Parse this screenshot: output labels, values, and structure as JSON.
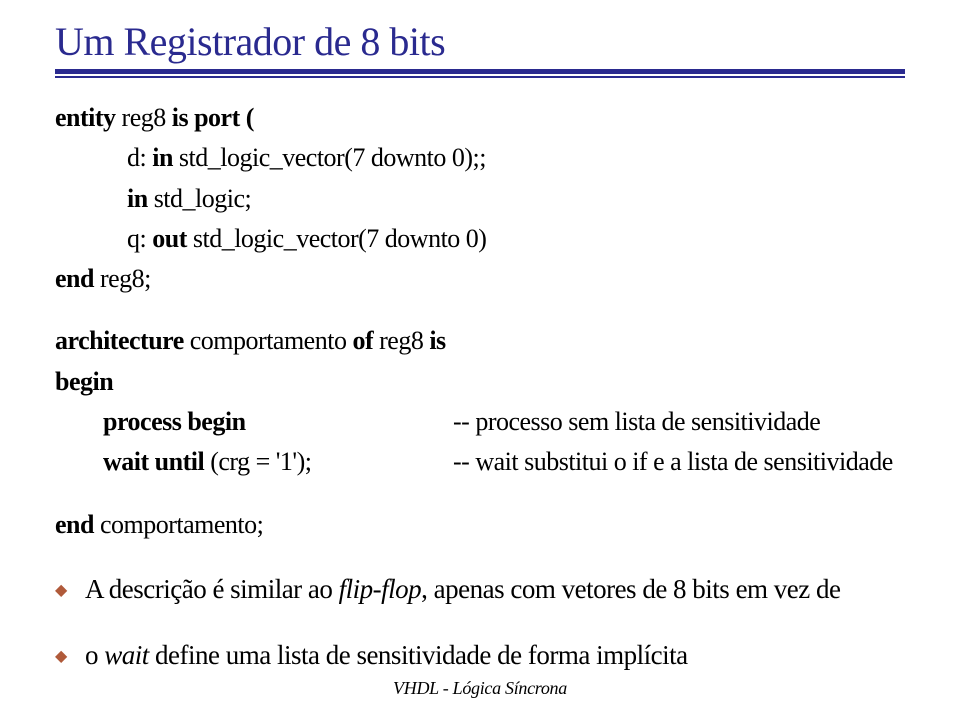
{
  "title": "Um Registrador de 8 bits",
  "code": {
    "l1a": "entity",
    "l1b": " reg8 ",
    "l1c": "is port (",
    "l2a": "d: ",
    "l2b": "in",
    "l2c": " std_logic_vector(7 downto 0);;",
    "l3a": "in",
    "l3b": " std_logic;",
    "l4a": "q: ",
    "l4b": "out",
    "l4c": " std_logic_vector(7 downto 0)",
    "l5a": "end",
    "l5b": " reg8;",
    "l6a": "architecture",
    "l6b": " comportamento ",
    "l6c": "of",
    "l6d": " reg8 ",
    "l6e": "is",
    "l7a": "begin",
    "l8a": "process begin",
    "l8c": "-- processo sem lista de sensitividade",
    "l9a": "wait until",
    "l9b": " (crg = '1');",
    "l9c": "-- wait substitui o if e a lista de sensitividade",
    "l10a": "end",
    "l10b": " comportamento;"
  },
  "bullets": {
    "b1a": "A descrição é similar ao ",
    "b1b": "flip-flop",
    "b1c": ", apenas com vetores de 8 bits em vez de",
    "b2a": "o ",
    "b2b": "wait",
    "b2c": " define uma lista de sensitividade de forma implícita"
  },
  "footer": "VHDL - Lógica Síncrona"
}
